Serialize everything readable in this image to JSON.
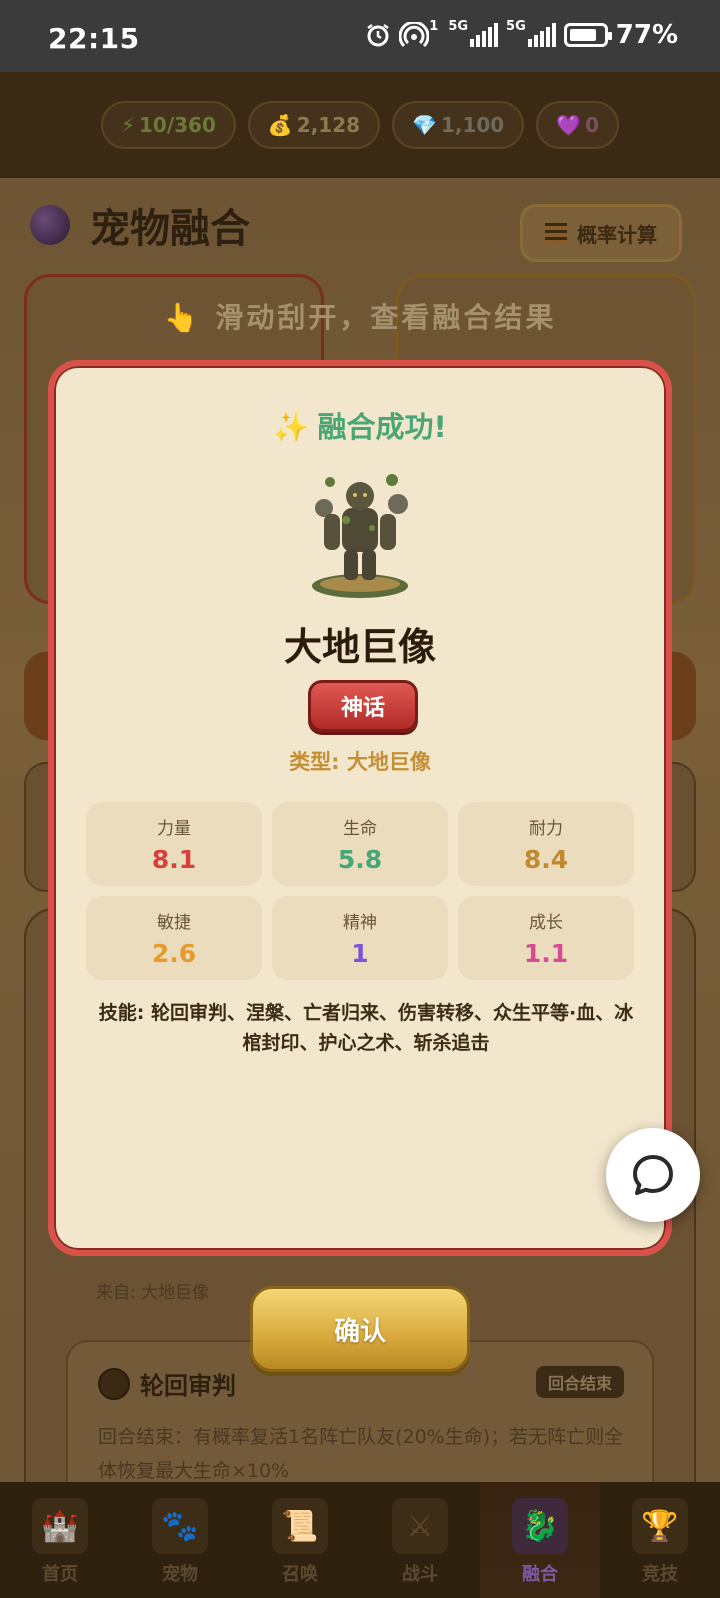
{
  "status_bar": {
    "time": "22:15",
    "sim1_label": "5G",
    "sim2_label": "5G",
    "hotspot_sup": "1",
    "battery": "77%"
  },
  "resources": [
    {
      "icon": "⚡",
      "value": "10/360"
    },
    {
      "icon": "💰",
      "value": "2,128"
    },
    {
      "icon": "💎",
      "value": "1,100"
    },
    {
      "icon": "💜",
      "value": "0"
    }
  ],
  "background": {
    "page_title": "宠物融合",
    "calc_button": "概率计算",
    "scratch_hint": "滑动刮开，查看融合结果",
    "scratch_hand": "👆",
    "from_text": "来自: 大地巨像",
    "skill_card": {
      "name": "轮回审判",
      "tag": "回合结束",
      "description": "回合结束：有概率复活1名阵亡队友(20%生命)；若无阵亡则全体恢复最大生命×10%"
    }
  },
  "modal": {
    "sparkle": "✨",
    "title": "融合成功!",
    "pet_name": "大地巨像",
    "rarity": "神话",
    "type_line": "类型: 大地巨像",
    "stats": [
      {
        "label": "力量",
        "value": "8.1",
        "color": "#d8413b"
      },
      {
        "label": "生命",
        "value": "5.8",
        "color": "#45a877"
      },
      {
        "label": "耐力",
        "value": "8.4",
        "color": "#c18a2c"
      },
      {
        "label": "敏捷",
        "value": "2.6",
        "color": "#e89a2e"
      },
      {
        "label": "精神",
        "value": "1",
        "color": "#7a55d8"
      },
      {
        "label": "成长",
        "value": "1.1",
        "color": "#d64a96"
      }
    ],
    "skills_text": "技能: 轮回审判、涅槃、亡者归来、伤害转移、众生平等·血、冰棺封印、护心之术、斩杀追击"
  },
  "confirm_button": "确认",
  "bottom_nav": [
    {
      "label": "首页",
      "icon": "🏰"
    },
    {
      "label": "宠物",
      "icon": "🐾"
    },
    {
      "label": "召唤",
      "icon": "📜"
    },
    {
      "label": "战斗",
      "icon": "⚔"
    },
    {
      "label": "融合",
      "icon": "🐉"
    },
    {
      "label": "竞技",
      "icon": "🏆"
    }
  ]
}
